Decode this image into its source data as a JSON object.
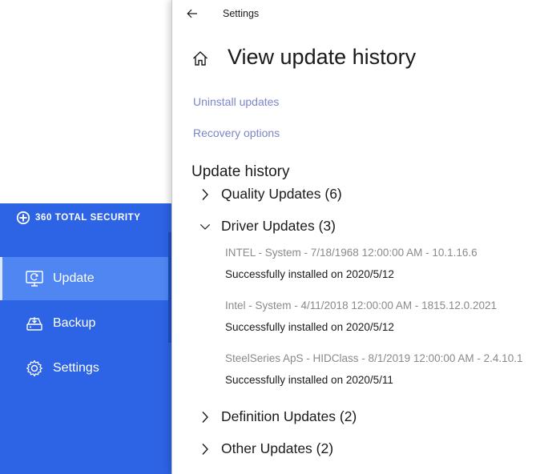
{
  "app360": {
    "brand": "360 TOTAL SECURITY",
    "nav": [
      {
        "label": "Update",
        "icon": "monitor-refresh-icon",
        "active": true
      },
      {
        "label": "Backup",
        "icon": "drive-icon",
        "active": false
      },
      {
        "label": "Settings",
        "icon": "gear-icon",
        "active": false
      }
    ],
    "colors": {
      "sidebar": "#2d63e5",
      "active": "#4f86f2"
    }
  },
  "settings": {
    "window_title": "Settings",
    "page_title": "View update history",
    "links": {
      "uninstall": "Uninstall updates",
      "recovery": "Recovery options"
    },
    "section_title": "Update history",
    "groups": {
      "quality": {
        "label": "Quality Updates (6)",
        "expanded": false
      },
      "driver": {
        "label": "Driver Updates (3)",
        "expanded": true
      },
      "definition": {
        "label": "Definition Updates (2)",
        "expanded": false
      },
      "other": {
        "label": "Other Updates (2)",
        "expanded": false
      }
    },
    "driver_updates": [
      {
        "name": "INTEL - System - 7/18/1968 12:00:00 AM - 10.1.16.6",
        "status": "Successfully installed on 2020/5/12"
      },
      {
        "name": "Intel - System - 4/11/2018 12:00:00 AM - 1815.12.0.2021",
        "status": "Successfully installed on 2020/5/12"
      },
      {
        "name": "SteelSeries ApS - HIDClass - 8/1/2019 12:00:00 AM - 2.4.10.1",
        "status": "Successfully installed on 2020/5/11"
      }
    ],
    "colors": {
      "link": "#7b86c8",
      "muted": "#8a8a8a"
    }
  }
}
